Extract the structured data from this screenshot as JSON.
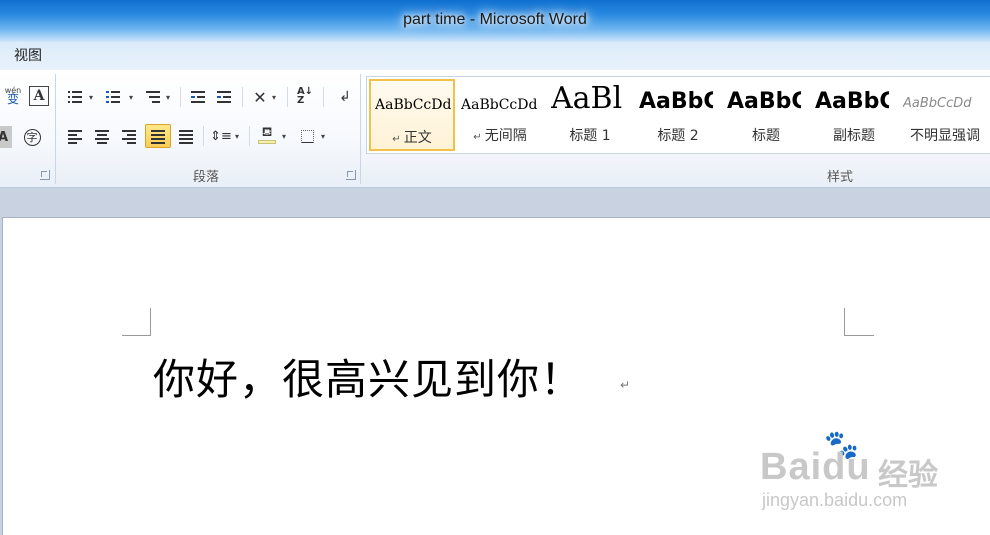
{
  "window": {
    "title": "part time - Microsoft Word"
  },
  "menu": {
    "items": [
      "视图"
    ]
  },
  "ribbon": {
    "groups": {
      "paragraph": {
        "label": "段落"
      },
      "styles": {
        "label": "样式"
      }
    },
    "font_partial": {
      "phonetic_icon_text": "wén",
      "phonetic_char": "变",
      "enclose_char": "字",
      "boxed_a": "A"
    },
    "styles_gallery": [
      {
        "preview": "AaBbCcDd",
        "name": "正文",
        "selected": true,
        "para_mark": true
      },
      {
        "preview": "AaBbCcDd",
        "name": "无间隔",
        "selected": false,
        "para_mark": true
      },
      {
        "preview": "AaBl",
        "name": "标题 1",
        "selected": false,
        "para_mark": false
      },
      {
        "preview": "AaBbC",
        "name": "标题 2",
        "selected": false,
        "para_mark": false
      },
      {
        "preview": "AaBbC",
        "name": "标题",
        "selected": false,
        "para_mark": false
      },
      {
        "preview": "AaBbC",
        "name": "副标题",
        "selected": false,
        "para_mark": false
      },
      {
        "preview": "AaBbCcDd",
        "name": "不明显强调",
        "selected": false,
        "para_mark": false
      }
    ]
  },
  "document": {
    "text": "你好，很高兴见到你！",
    "paragraph_mark": "↵"
  },
  "watermark": {
    "logo": "Baidu",
    "label": "经验",
    "url": "jingyan.baidu.com"
  },
  "colors": {
    "title_bar": "#2a8ae0",
    "selected_style_border": "#f1c14a",
    "active_button": "#f8cd55",
    "doc_background": "#c8d2e0"
  }
}
